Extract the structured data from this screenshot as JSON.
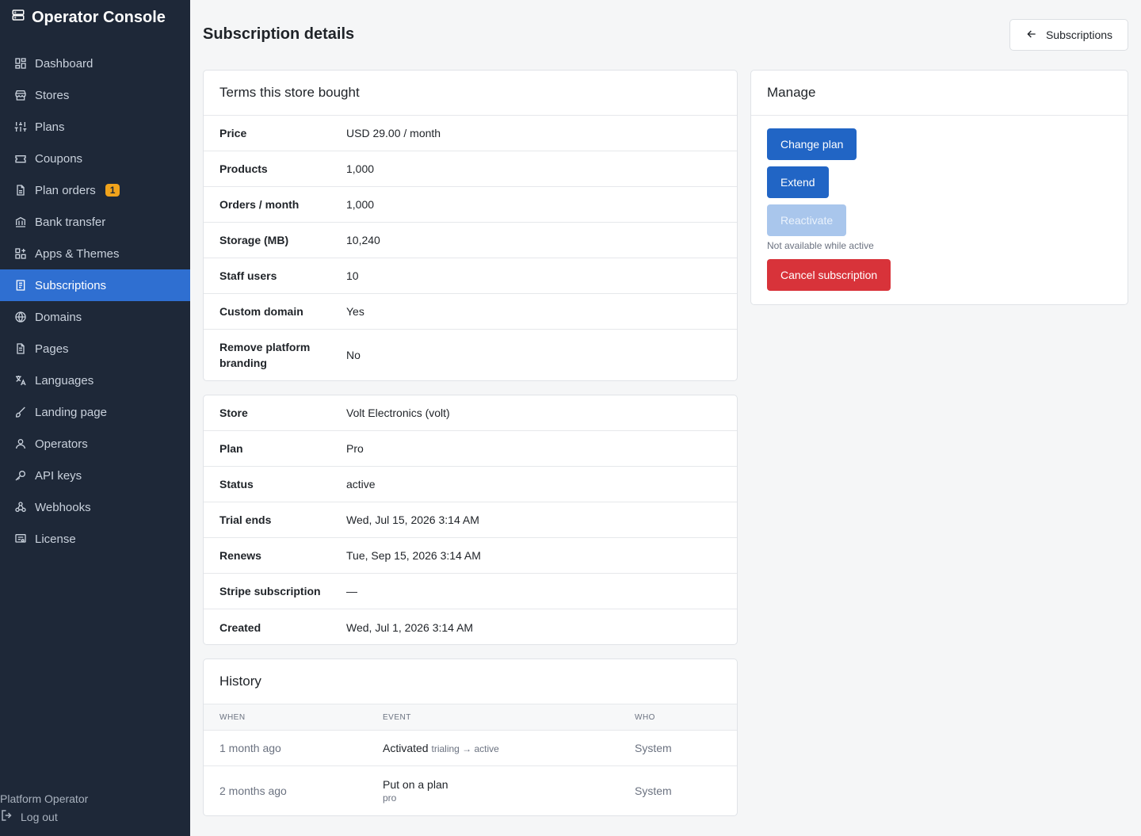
{
  "app": {
    "title": "Operator Console"
  },
  "sidebar": {
    "items": [
      {
        "label": "Dashboard",
        "icon": "dashboard-icon"
      },
      {
        "label": "Stores",
        "icon": "store-icon"
      },
      {
        "label": "Plans",
        "icon": "sliders-icon"
      },
      {
        "label": "Coupons",
        "icon": "ticket-icon"
      },
      {
        "label": "Plan orders",
        "icon": "file-icon",
        "badge": "1"
      },
      {
        "label": "Bank transfer",
        "icon": "bank-icon"
      },
      {
        "label": "Apps & Themes",
        "icon": "apps-icon"
      },
      {
        "label": "Subscriptions",
        "icon": "receipt-icon",
        "active": true
      },
      {
        "label": "Domains",
        "icon": "globe-icon"
      },
      {
        "label": "Pages",
        "icon": "page-icon"
      },
      {
        "label": "Languages",
        "icon": "translate-icon"
      },
      {
        "label": "Landing page",
        "icon": "brush-icon"
      },
      {
        "label": "Operators",
        "icon": "user-icon"
      },
      {
        "label": "API keys",
        "icon": "key-icon"
      },
      {
        "label": "Webhooks",
        "icon": "webhook-icon"
      },
      {
        "label": "License",
        "icon": "license-icon"
      }
    ],
    "user_name": "Platform Operator",
    "logout_label": "Log out"
  },
  "header": {
    "title": "Subscription details",
    "back_label": "Subscriptions"
  },
  "terms": {
    "title": "Terms this store bought",
    "rows": [
      {
        "k": "Price",
        "v": "USD 29.00 / month"
      },
      {
        "k": "Products",
        "v": "1,000"
      },
      {
        "k": "Orders / month",
        "v": "1,000"
      },
      {
        "k": "Storage (MB)",
        "v": "10,240"
      },
      {
        "k": "Staff users",
        "v": "10"
      },
      {
        "k": "Custom domain",
        "v": "Yes"
      },
      {
        "k": "Remove platform branding",
        "v": "No"
      }
    ]
  },
  "details": {
    "rows": [
      {
        "k": "Store",
        "v": "Volt Electronics (volt)"
      },
      {
        "k": "Plan",
        "v": "Pro"
      },
      {
        "k": "Status",
        "v": "active"
      },
      {
        "k": "Trial ends",
        "v": "Wed, Jul 15, 2026 3:14 AM"
      },
      {
        "k": "Renews",
        "v": "Tue, Sep 15, 2026 3:14 AM"
      },
      {
        "k": "Stripe subscription",
        "v": "—"
      },
      {
        "k": "Created",
        "v": "Wed, Jul 1, 2026 3:14 AM"
      }
    ]
  },
  "history": {
    "title": "History",
    "columns": [
      "WHEN",
      "EVENT",
      "WHO"
    ],
    "rows": [
      {
        "when": "1 month ago",
        "event": "Activated",
        "detail": "trialing → active",
        "who": "System"
      },
      {
        "when": "2 months ago",
        "event": "Put on a plan",
        "detail": "pro",
        "who": "System"
      }
    ]
  },
  "manage": {
    "title": "Manage",
    "change_plan": "Change plan",
    "extend": "Extend",
    "reactivate": "Reactivate",
    "reactivate_hint": "Not available while active",
    "cancel": "Cancel subscription"
  },
  "colors": {
    "sidebar_bg": "#1e2838",
    "active_nav": "#2f6fd1",
    "primary": "#2165c5",
    "danger": "#d8333a",
    "badge": "#f0a31c"
  }
}
